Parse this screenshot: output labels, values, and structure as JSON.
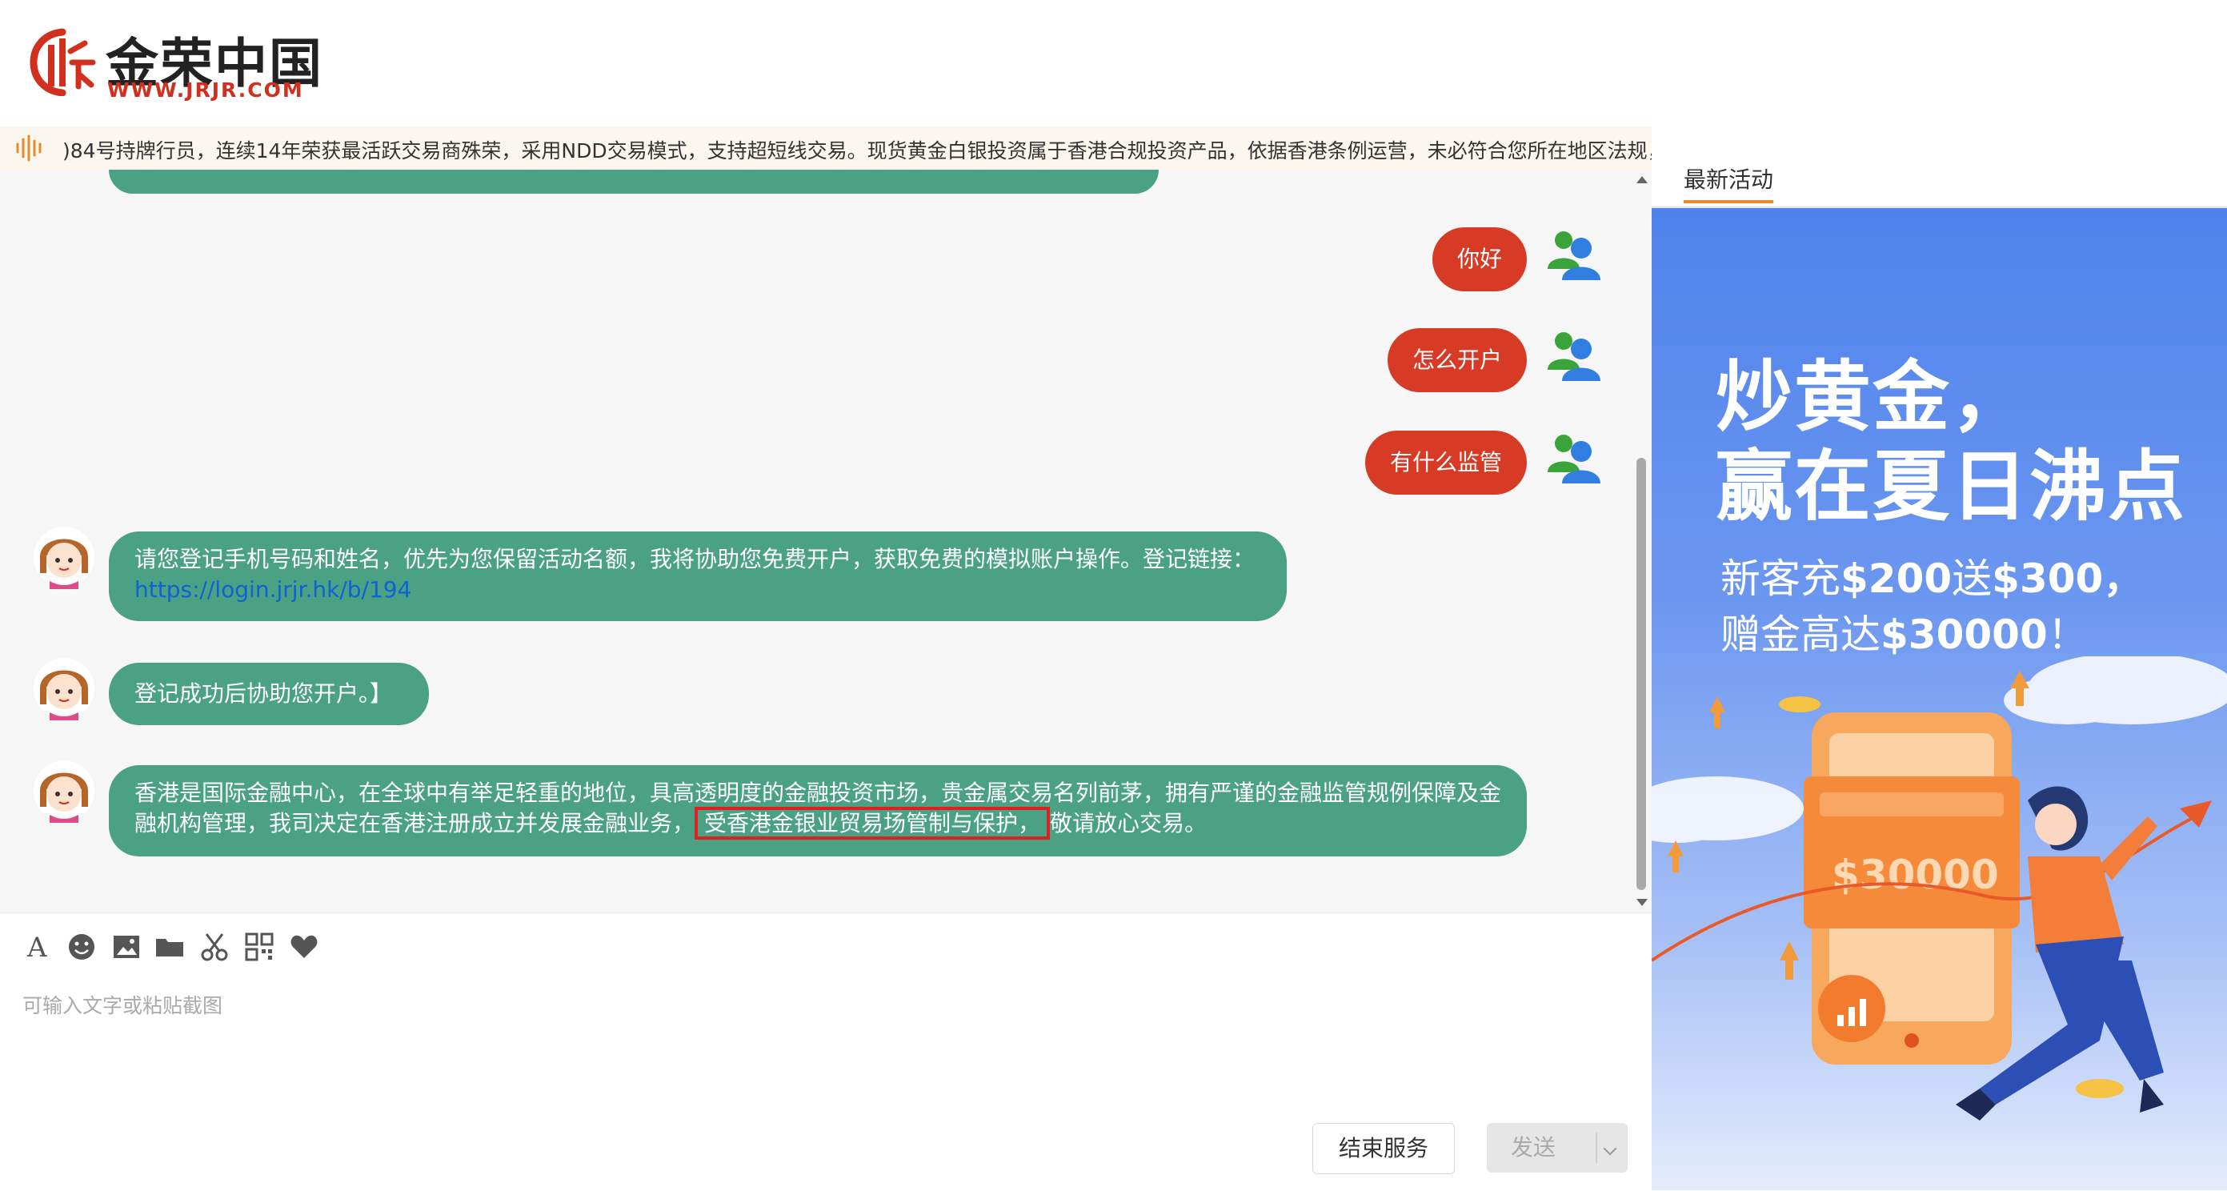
{
  "brand": {
    "name": "金荣中国",
    "url": "WWW.JRJR.COM",
    "color": "#d0301d"
  },
  "ticker": {
    "text": ")84号持牌行员，连续14年荣获最活跃交易商殊荣，采用NDD交易模式，支持超短线交易。现货黄金白银投资属于香港合规投资产品，依据香港条例运营，未必符合您所在地区法规，投资需"
  },
  "chat": {
    "user_messages": [
      {
        "text": "你好"
      },
      {
        "text": "怎么开户"
      },
      {
        "text": "有什么监管"
      }
    ],
    "agent_messages": [
      {
        "text": "请您登记手机号码和姓名，优先为您保留活动名额，我将协助您免费开户，获取免费的模拟账户操作。登记链接：",
        "link": "https://login.jrjr.hk/b/194"
      },
      {
        "text": "登记成功后协助您开户。】"
      },
      {
        "text_before": "香港是国际金融中心，在全球中有举足轻重的地位，具高透明度的金融投资市场，贵金属交易名列前茅，拥有严谨的金融监管规例保障及金融机构管理，我司决定在香港注册成立并发展金融业务，",
        "text_highlight": "受香港金银业贸易场管制与保护，",
        "text_after": "敬请放心交易。"
      }
    ],
    "colors": {
      "user_bubble": "#d73a25",
      "agent_bubble": "#4aa184",
      "background": "#f6f6f6"
    }
  },
  "toolbar": {
    "icons": [
      "font-icon",
      "emoji-icon",
      "image-icon",
      "folder-icon",
      "scissors-icon",
      "qrcode-icon",
      "heart-icon"
    ]
  },
  "input": {
    "placeholder": "可输入文字或粘贴截图"
  },
  "buttons": {
    "end_service": "结束服务",
    "send": "发送"
  },
  "sidebar": {
    "tab_label": "最新活动",
    "accent": "#e88b2e",
    "banner": {
      "headline_line1": "炒黄金，",
      "headline_line2": "赢在夏日沸点",
      "promo_line1_a": "新客充",
      "promo_line1_b": "$200",
      "promo_line1_c": "送",
      "promo_line1_d": "$300，",
      "promo_line2_a": "赠金高达",
      "promo_line2_b": "$30000",
      "promo_line2_c": "！",
      "amount_label": "$30000"
    }
  }
}
